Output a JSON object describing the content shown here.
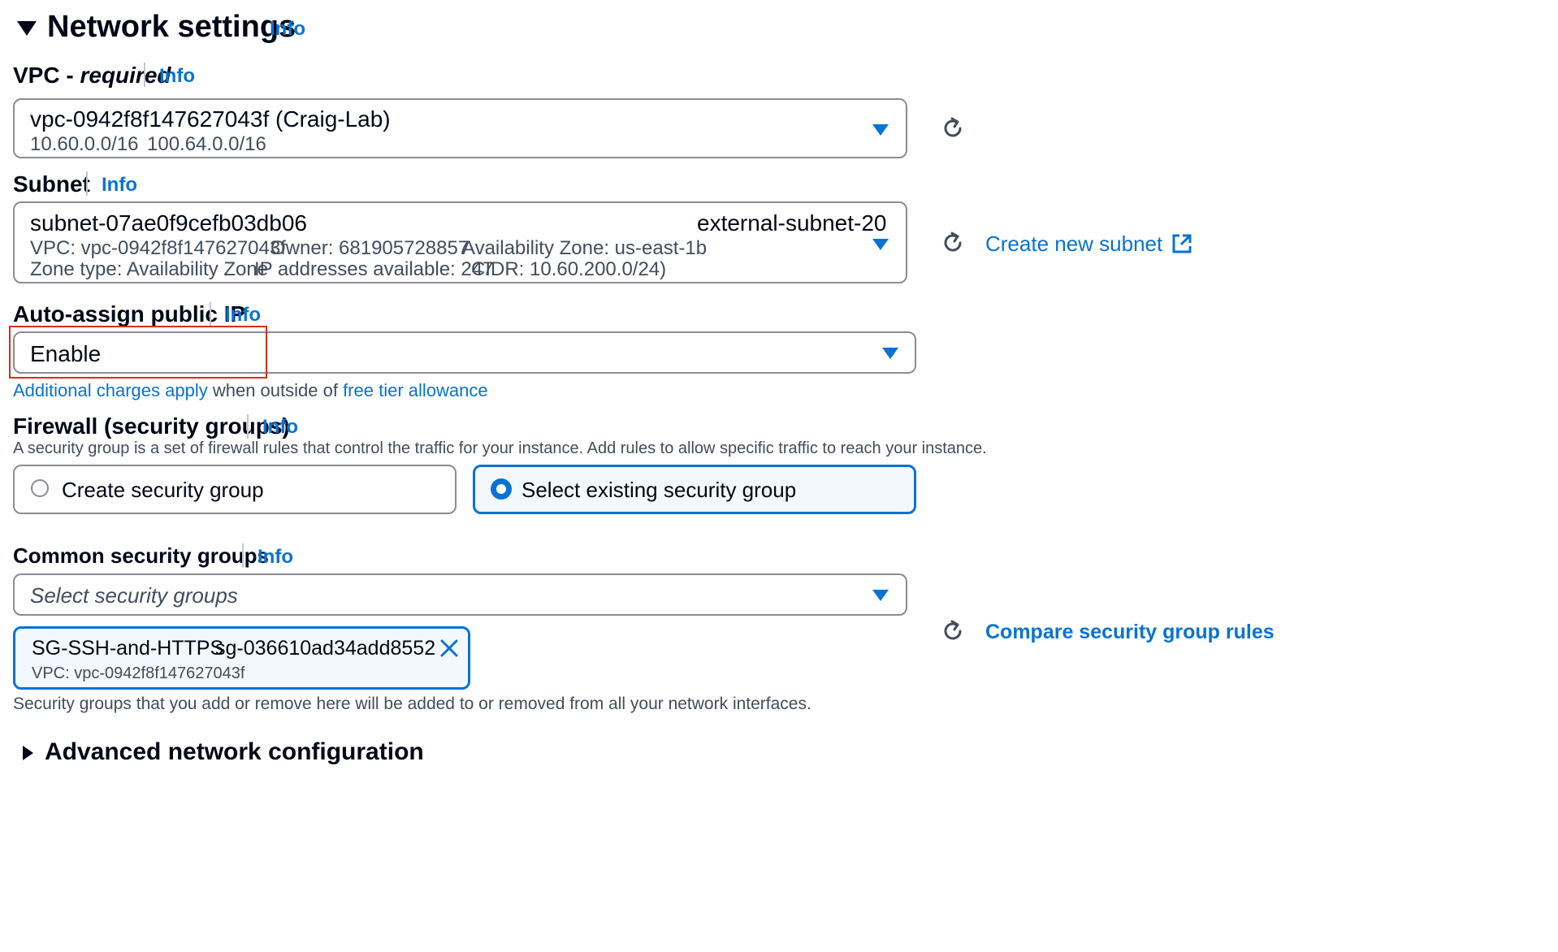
{
  "section": {
    "title": "Network settings",
    "info": "Info"
  },
  "vpc": {
    "label_main": "VPC - ",
    "label_req": "required",
    "info": "Info",
    "selected": "vpc-0942f8f147627043f (Craig-Lab)",
    "cidr1": "10.60.0.0/16",
    "cidr2": "100.64.0.0/16"
  },
  "subnet": {
    "label": "Subnet",
    "info": "Info",
    "selected": "subnet-07ae0f9cefb03db06",
    "name": "external-subnet-20",
    "vpc": "VPC: vpc-0942f8f147627043f",
    "owner": "Owner: 681905728857",
    "az": "Availability Zone: us-east-1b",
    "zone_type": "Zone type: Availability Zone",
    "ips": "IP addresses available: 247",
    "cidr": "CIDR: 10.60.200.0/24)",
    "create_link": "Create new subnet"
  },
  "public_ip": {
    "label": "Auto-assign public IP",
    "info": "Info",
    "selected": "Enable",
    "charges_link": "Additional charges apply",
    "charges_text": " when outside of ",
    "free_tier_link": "free tier allowance"
  },
  "firewall": {
    "label": "Firewall (security groups)",
    "info": "Info",
    "description": "A security group is a set of firewall rules that control the traffic for your instance. Add rules to allow specific traffic to reach your instance.",
    "option_create": "Create security group",
    "option_select": "Select existing security group"
  },
  "common_sg": {
    "label": "Common security groups",
    "info": "Info",
    "placeholder": "Select security groups",
    "token_name": "SG-SSH-and-HTTPS",
    "token_id": "sg-036610ad34add8552",
    "token_vpc": "VPC: vpc-0942f8f147627043f",
    "compare_link": "Compare security group rules",
    "note": "Security groups that you add or remove here will be added to or removed from all your network interfaces."
  },
  "advanced": {
    "title": "Advanced network configuration"
  },
  "colors": {
    "link": "#0972d3",
    "highlight_border": "#d13212",
    "selected_card_bg": "#f2f8fd"
  }
}
